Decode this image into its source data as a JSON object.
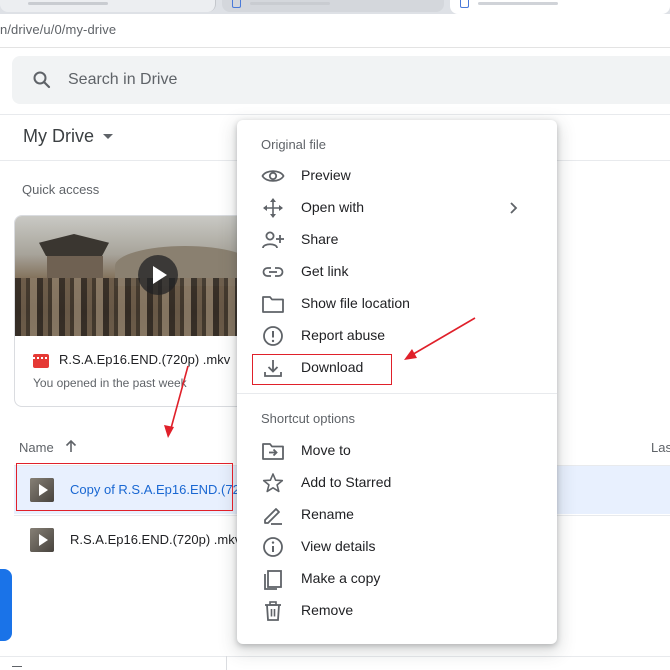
{
  "browser": {
    "url": "n/drive/u/0/my-drive"
  },
  "search": {
    "placeholder": "Search in Drive",
    "icon": "search-icon"
  },
  "header": {
    "title": "My Drive"
  },
  "quick_access": {
    "title": "Quick access",
    "card": {
      "file_name": "R.S.A.Ep16.END.(720p) .mkv",
      "subtitle": "You opened in the past week",
      "icon": "video-file-icon"
    }
  },
  "file_list": {
    "columns": {
      "name": "Name",
      "last": "Las"
    },
    "rows": [
      {
        "name": "Copy of R.S.A.Ep16.END.(720",
        "selected": true
      },
      {
        "name": "R.S.A.Ep16.END.(720p) .mkv",
        "selected": false
      }
    ]
  },
  "context_menu": {
    "section_original": "Original file",
    "items_original": [
      {
        "label": "Preview",
        "icon": "eye-icon"
      },
      {
        "label": "Open with",
        "icon": "move-arrows-icon",
        "submenu": true
      },
      {
        "label": "Share",
        "icon": "person-add-icon"
      },
      {
        "label": "Get link",
        "icon": "link-icon"
      },
      {
        "label": "Show file location",
        "icon": "folder-icon"
      },
      {
        "label": "Report abuse",
        "icon": "alert-circle-icon"
      },
      {
        "label": "Download",
        "icon": "download-icon"
      }
    ],
    "section_shortcut": "Shortcut options",
    "items_shortcut": [
      {
        "label": "Move to",
        "icon": "folder-move-icon"
      },
      {
        "label": "Add to Starred",
        "icon": "star-icon"
      },
      {
        "label": "Rename",
        "icon": "pencil-icon"
      },
      {
        "label": "View details",
        "icon": "info-icon"
      },
      {
        "label": "Make a copy",
        "icon": "copy-icon"
      },
      {
        "label": "Remove",
        "icon": "trash-icon"
      }
    ]
  },
  "colors": {
    "accent": "#1a73e8",
    "selected_row_bg": "#e8f0fe",
    "selected_text": "#1967d2",
    "annotation_red": "#e0202a"
  }
}
